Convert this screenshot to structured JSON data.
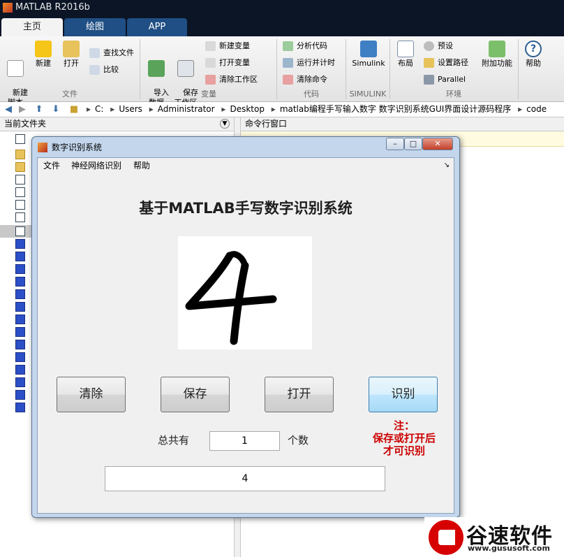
{
  "app": {
    "title": "MATLAB R2016b"
  },
  "tabs": [
    {
      "label": "主页"
    },
    {
      "label": "绘图"
    },
    {
      "label": "APP"
    }
  ],
  "ribbon": {
    "big_buttons": [
      {
        "label": "新建\n脚本"
      },
      {
        "label": "新建"
      },
      {
        "label": "打开"
      },
      {
        "label": "导入\n数据"
      },
      {
        "label": "保存\n工作区"
      },
      {
        "label": "Simulink"
      },
      {
        "label": "布局"
      },
      {
        "label": "附加功能"
      },
      {
        "label": "帮助"
      }
    ],
    "small_buttons": {
      "find_files": "查找文件",
      "compare": "比较",
      "new_variable": "新建变量",
      "open_variable": "打开变量",
      "clear_workspace": "清除工作区",
      "analyze_code": "分析代码",
      "run_and_time": "运行并计时",
      "clear_commands": "清除命令",
      "preferences": "预设",
      "set_path": "设置路径",
      "parallel": "Parallel"
    },
    "sections": {
      "file": "文件",
      "variable": "变量",
      "code": "代码",
      "simulink": "SIMULINK",
      "environment": "环境"
    }
  },
  "address_bar": {
    "breadcrumbs": [
      "C:",
      "Users",
      "Administrator",
      "Desktop",
      "matlab编程手写输入数字 数字识别系统GUI界面设计源码程序",
      "code"
    ]
  },
  "left_pane": {
    "title": "当前文件夹"
  },
  "right_pane": {
    "title": "命令行窗口"
  },
  "figure": {
    "title": "数字识别系统",
    "menu": {
      "file": "文件",
      "nn_recognize": "神经网络识别",
      "help": "帮助"
    },
    "heading": "基于MATLAB手写数字识别系统",
    "drawn_digit": "4",
    "buttons": {
      "clear": "清除",
      "save": "保存",
      "open": "打开",
      "recognize": "识别"
    },
    "total_label": "总共有",
    "count_value": "1",
    "count_unit": "个数",
    "note": {
      "line1": "注：",
      "line2": "保存或打开后",
      "line3": "才可识别"
    },
    "result": "4"
  },
  "watermark": {
    "name": "谷速软件",
    "url": "www.gususoft.com"
  },
  "colors": {
    "accent": "#1f4f84",
    "note_red": "#cc0000",
    "title_bar": "#0b1526"
  }
}
